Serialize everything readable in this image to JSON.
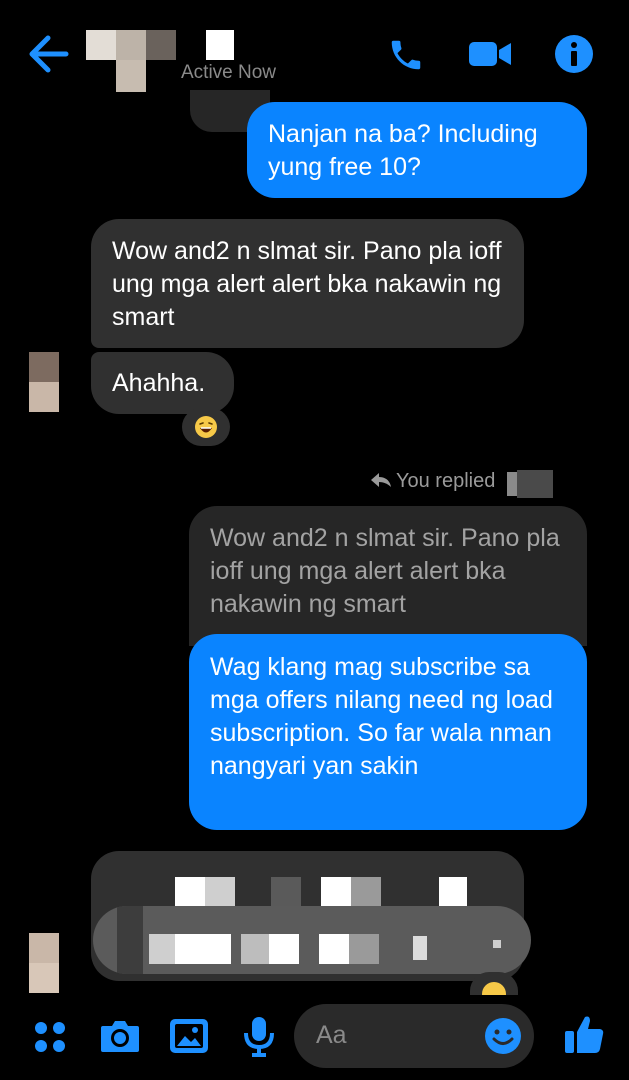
{
  "header": {
    "status": "Active Now",
    "icons": [
      "back-arrow-icon",
      "phone-icon",
      "video-icon",
      "info-icon"
    ]
  },
  "messages": [
    {
      "side": "out",
      "text": "Nanjan na ba? Including yung free 10?"
    },
    {
      "side": "in",
      "text": "Wow and2 n slmat sir. Pano pla ioff ung mga alert alert bka nakawin ng smart"
    },
    {
      "side": "in",
      "text": "Ahahha.",
      "reaction": "laughing-emoji"
    },
    {
      "side": "out",
      "reply_label": "You replied",
      "quoted": "Wow and2 n slmat sir. Pano pla ioff ung mga alert alert bka nakawin ng smart",
      "text": "Wag klang mag subscribe sa mga offers nilang need ng load subscription. So far wala nman nangyari yan sakin"
    }
  ],
  "composer": {
    "placeholder": "Aa",
    "icons": [
      "apps-icon",
      "camera-icon",
      "gallery-icon",
      "mic-icon",
      "emoji-icon",
      "thumbs-up-icon"
    ]
  },
  "colors": {
    "accent": "#1e90ff",
    "bubble_out": "#0a84ff",
    "bubble_in": "#303030",
    "background": "#000000"
  }
}
